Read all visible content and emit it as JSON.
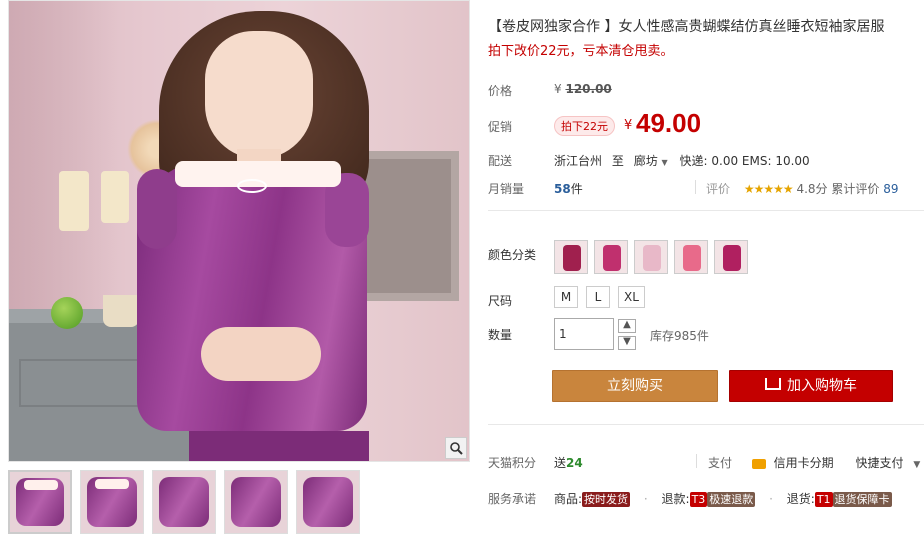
{
  "gallery": {
    "main_image_alt": "",
    "thumbnail_count": 5
  },
  "product": {
    "title": "【卷皮网独家合作 】女人性感高贵蝴蝶结仿真丝睡衣短袖家居服",
    "subtitle": "拍下改价22元，亏本清仓甩卖。"
  },
  "price": {
    "label": "价格",
    "currency": "¥",
    "original": "120.00"
  },
  "promo": {
    "label": "促销",
    "tag": "拍下22元",
    "currency": "¥",
    "price": "49.00"
  },
  "shipping": {
    "label": "配送",
    "from": "浙江台州",
    "to_word": "至",
    "to": "廊坊",
    "fees": "快递: 0.00 EMS: 10.00"
  },
  "sales": {
    "label": "月销量",
    "count": "58",
    "unit": "件",
    "review_label": "评价",
    "stars": "★★★★★",
    "score": "4.8分",
    "review_text": "累计评价",
    "review_count": "89"
  },
  "color": {
    "label": "颜色分类",
    "swatch_colors": [
      "#a0204e",
      "#c0306e",
      "#e8b8c8",
      "#e86a8a",
      "#b02060"
    ]
  },
  "size": {
    "label": "尺码",
    "options": [
      "M",
      "L",
      "XL"
    ]
  },
  "quantity": {
    "label": "数量",
    "value": "1",
    "up": "▲",
    "down": "▼",
    "stock": "库存985件"
  },
  "buttons": {
    "buy_now": "立刻购买",
    "add_cart": "加入购物车"
  },
  "points": {
    "label": "天猫积分",
    "prefix": "送",
    "value": "24",
    "pay_label": "支付",
    "credit": "信用卡分期",
    "fast_pay": "快捷支付"
  },
  "service": {
    "label": "服务承诺",
    "item1_prefix": "商品:",
    "item1_tag": "按时发货",
    "item2_prefix": "退款:",
    "item2_code": "T3",
    "item2_tag": "极速退款",
    "item3_prefix": "退货:",
    "item3_code": "T1",
    "item3_tag": "退货保障卡"
  },
  "colors": {
    "accent_red": "#c40000",
    "buy_orange": "#c9853d",
    "link_blue": "#2a5e9b"
  }
}
